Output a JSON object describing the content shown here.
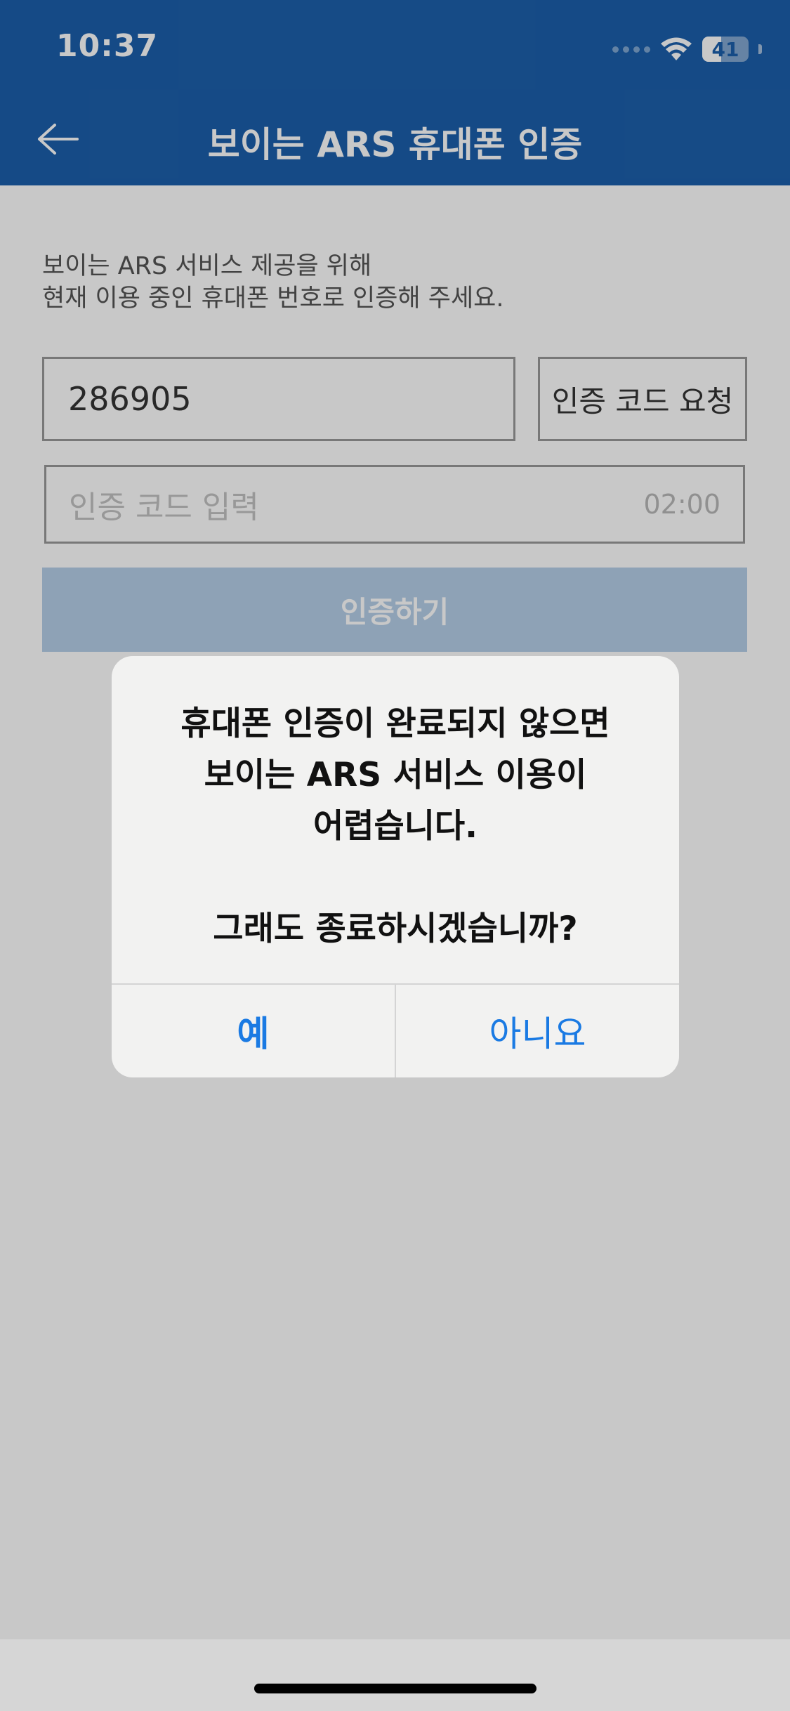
{
  "status_bar": {
    "time": "10:37",
    "battery_level": "41",
    "battery_fraction": 0.41
  },
  "nav": {
    "title": "보이는 ARS 휴대폰 인증",
    "back_icon": "arrow-left-icon"
  },
  "form": {
    "description": "보이는 ARS 서비스 제공을 위해\n현재 이용 중인 휴대폰 번호로 인증해 주세요.",
    "phone_value": "286905",
    "request_code_label": "인증 코드 요청",
    "code_placeholder": "인증 코드 입력",
    "code_timer": "02:00",
    "verify_label": "인증하기"
  },
  "alert": {
    "message": "휴대폰 인증이 완료되지 않으면\n보이는 ARS 서비스 이용이\n어렵습니다.\n\n그래도 종료하시겠습니까?",
    "yes_label": "예",
    "no_label": "아니요"
  },
  "colors": {
    "header_bg": "#1c5fab",
    "alert_button": "#1a7ae3",
    "verify_button_disabled": "#b6cfe9"
  }
}
